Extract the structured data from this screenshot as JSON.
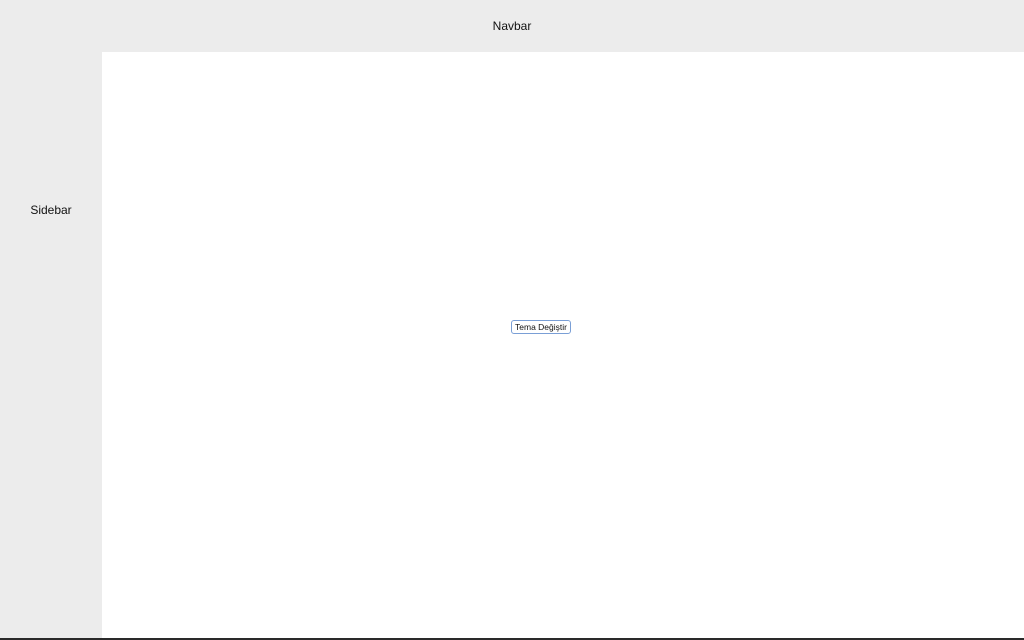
{
  "navbar": {
    "label": "Navbar"
  },
  "sidebar": {
    "label": "Sidebar"
  },
  "main": {
    "theme_button_label": "Tema Değiştir"
  },
  "colors": {
    "panel_background": "#ececec",
    "main_background": "#ffffff",
    "button_border": "#7a9fd6"
  }
}
